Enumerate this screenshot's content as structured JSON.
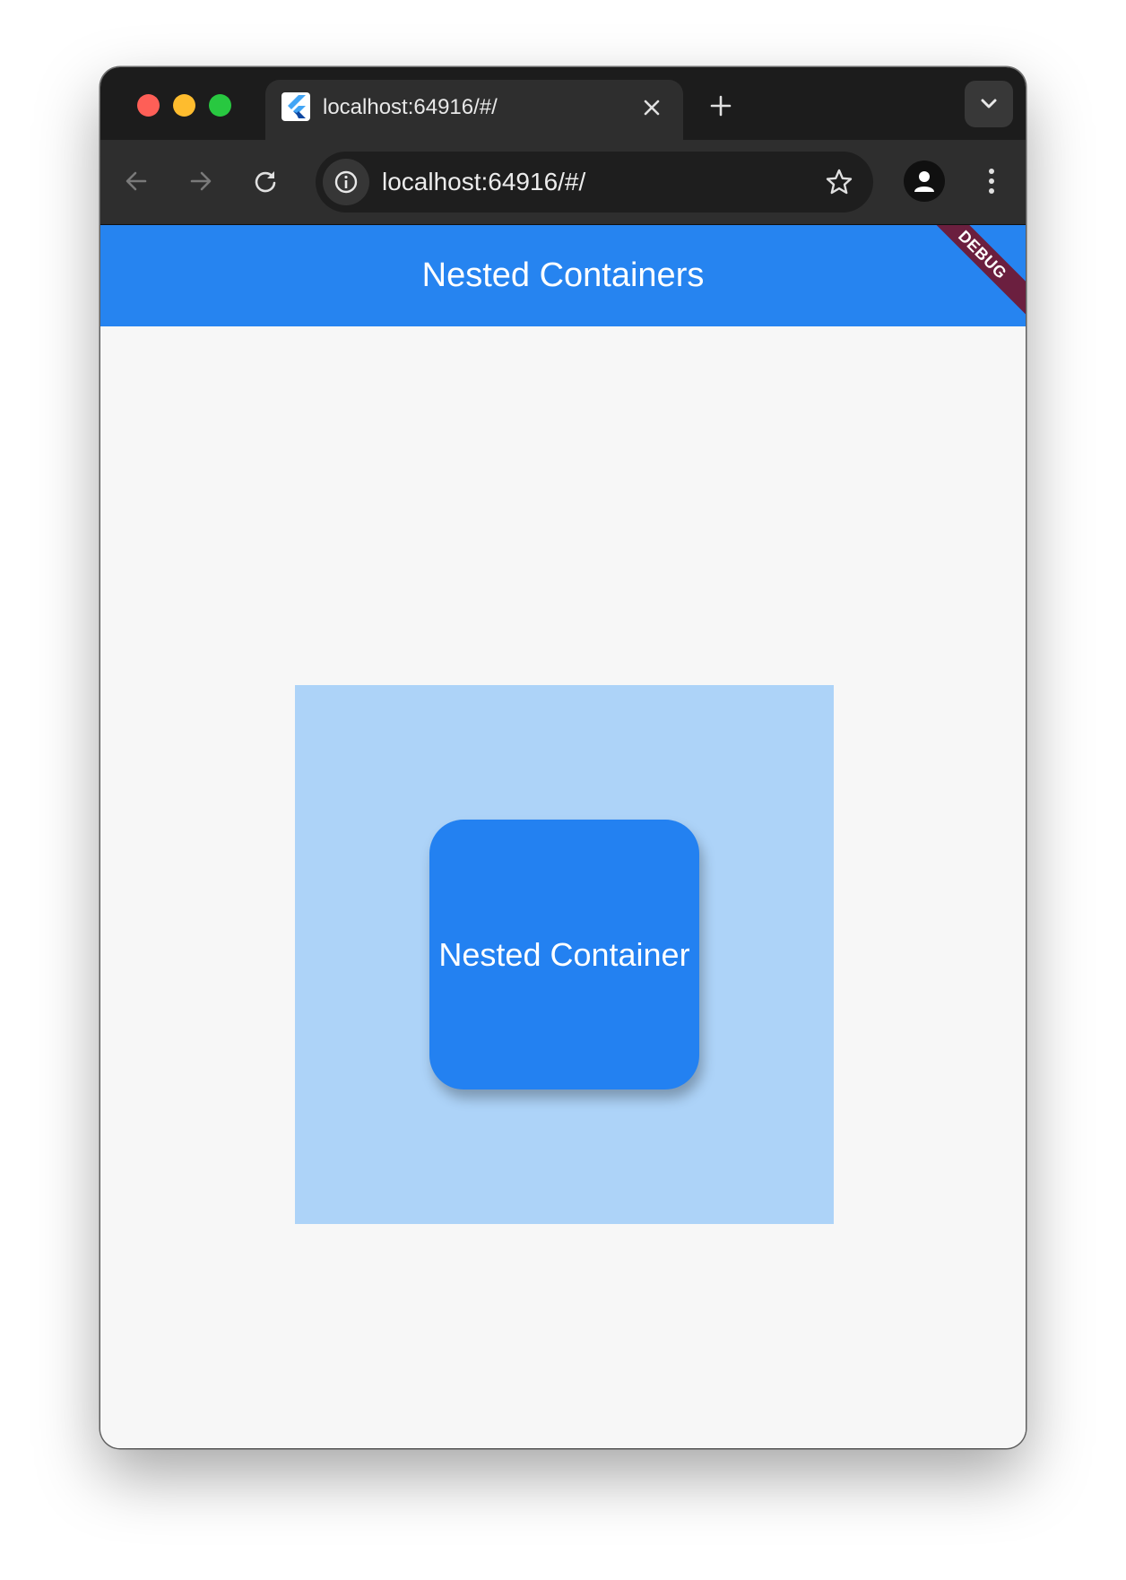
{
  "browser": {
    "tab": {
      "title": "localhost:64916/#/",
      "favicon": "flutter-icon"
    },
    "address_bar": {
      "url": "localhost:64916/#/"
    },
    "icons": {
      "back": "arrow-left-icon",
      "forward": "arrow-right-icon",
      "reload": "reload-icon",
      "site_info": "info-icon",
      "bookmark": "star-icon",
      "profile": "person-icon",
      "menu": "kebab-menu-icon",
      "new_tab": "plus-icon",
      "tab_close": "close-icon",
      "tab_search": "chevron-down-icon"
    }
  },
  "app": {
    "appbar_title": "Nested Containers",
    "debug_banner": "DEBUG",
    "inner_label": "Nested Container",
    "colors": {
      "appbar": "#2684f0",
      "outer_container": "#add3f8",
      "inner_container": "#2381f1",
      "background": "#f7f7f7",
      "debug_banner": "#6b1f3f"
    }
  }
}
